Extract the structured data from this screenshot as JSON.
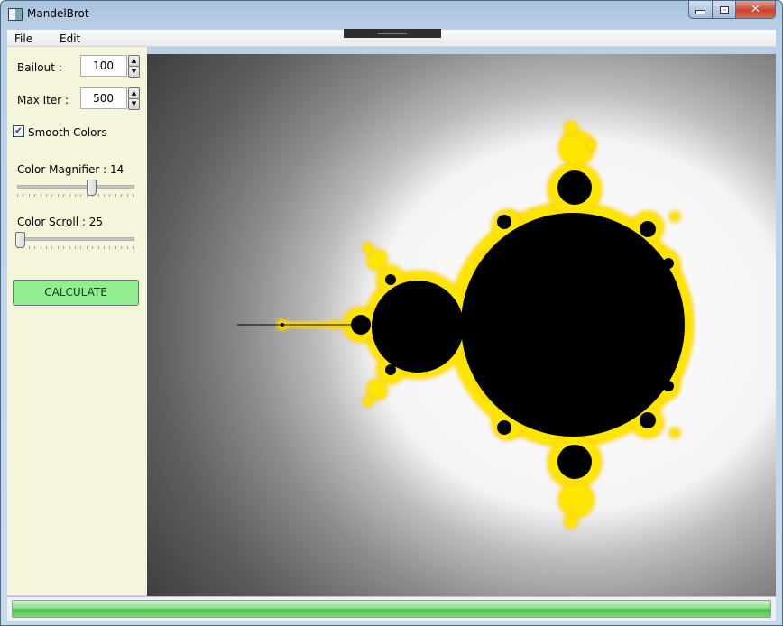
{
  "window": {
    "title": "MandelBrot"
  },
  "menu": {
    "file": "File",
    "edit": "Edit"
  },
  "controls": {
    "bailout": {
      "label": "Bailout :",
      "value": "100"
    },
    "max_iter": {
      "label": "Max Iter :",
      "value": "500"
    },
    "smooth_colors": {
      "label": "Smooth Colors",
      "checked": true
    },
    "color_magnifier": {
      "label": "Color Magnifier : 14",
      "value": 14
    },
    "color_scroll": {
      "label": "Color Scroll : 25",
      "value": 25
    },
    "calculate_label": "CALCULATE"
  },
  "colors": {
    "calculate_button": "#90ee90",
    "sidebar": "#f5f5dc",
    "fractal_edge": "#ffe600",
    "fractal_inner": "#000000"
  },
  "progress": {
    "value": 1.0
  },
  "icons": {
    "app": "window-icon",
    "minimize": "minimize-icon",
    "maximize": "maximize-icon",
    "close": "close-icon",
    "spin_up": "arrow-up-icon",
    "spin_down": "arrow-down-icon",
    "check": "checkmark-icon"
  }
}
